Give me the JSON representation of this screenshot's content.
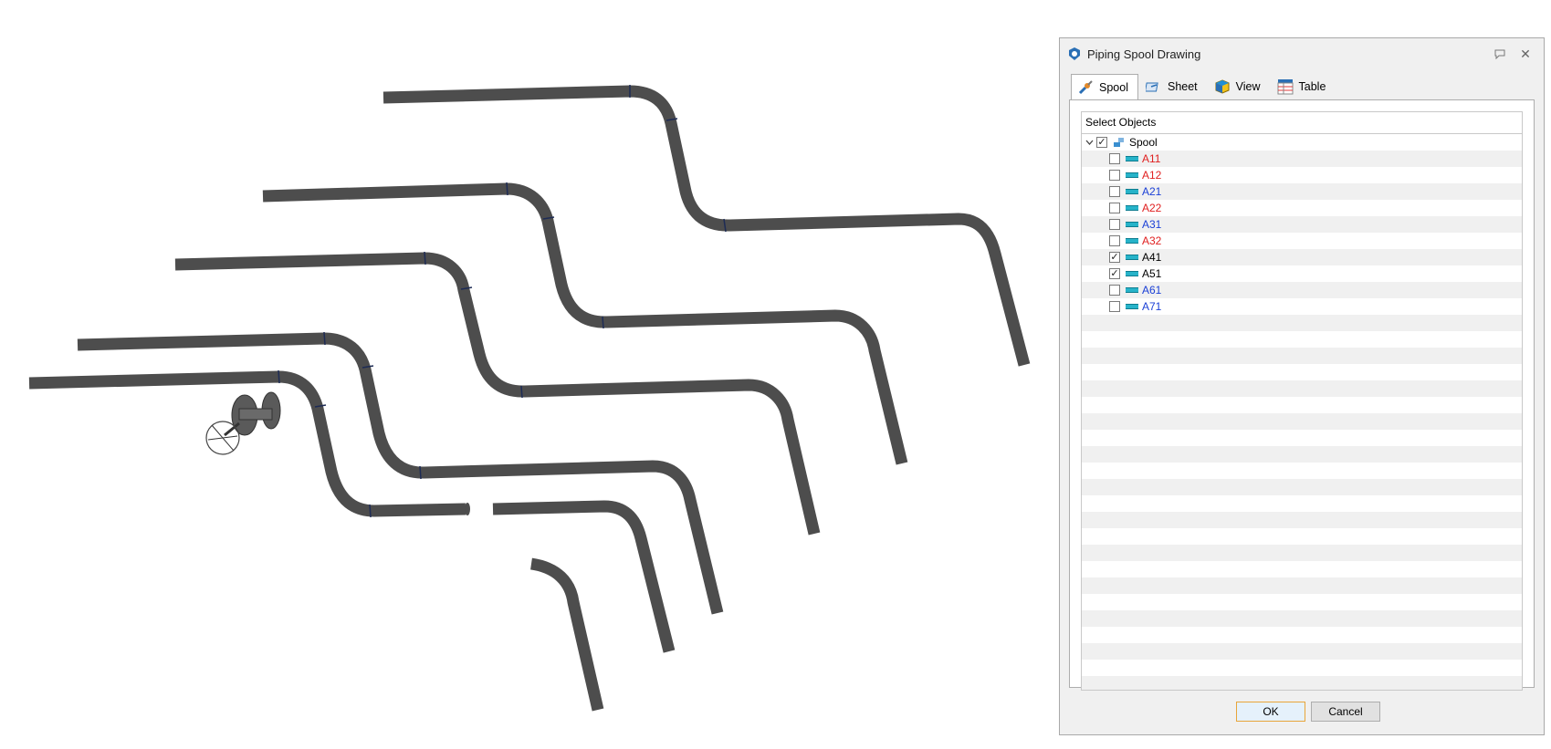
{
  "dialog": {
    "title": "Piping Spool Drawing",
    "tabs": [
      {
        "label": "Spool",
        "icon": "spool-icon",
        "active": true
      },
      {
        "label": "Sheet",
        "icon": "sheet-icon",
        "active": false
      },
      {
        "label": "View",
        "icon": "view-cube-icon",
        "active": false
      },
      {
        "label": "Table",
        "icon": "bom-table-icon",
        "active": false
      }
    ],
    "tree": {
      "header": "Select Objects",
      "root": {
        "label": "Spool",
        "checked": true,
        "expanded": true
      },
      "items": [
        {
          "label": "A11",
          "checked": false,
          "color": "#e02020"
        },
        {
          "label": "A12",
          "checked": false,
          "color": "#e02020"
        },
        {
          "label": "A21",
          "checked": false,
          "color": "#1a3fd6"
        },
        {
          "label": "A22",
          "checked": false,
          "color": "#e02020"
        },
        {
          "label": "A31",
          "checked": false,
          "color": "#1a3fd6"
        },
        {
          "label": "A32",
          "checked": false,
          "color": "#e02020"
        },
        {
          "label": "A41",
          "checked": true,
          "color": "#000000"
        },
        {
          "label": "A51",
          "checked": true,
          "color": "#000000"
        },
        {
          "label": "A61",
          "checked": false,
          "color": "#1a3fd6"
        },
        {
          "label": "A71",
          "checked": false,
          "color": "#1a3fd6"
        }
      ]
    },
    "buttons": {
      "ok": "OK",
      "cancel": "Cancel"
    }
  },
  "colors": {
    "pipe": "#4d4d4d",
    "accent": "#e8a53a"
  }
}
